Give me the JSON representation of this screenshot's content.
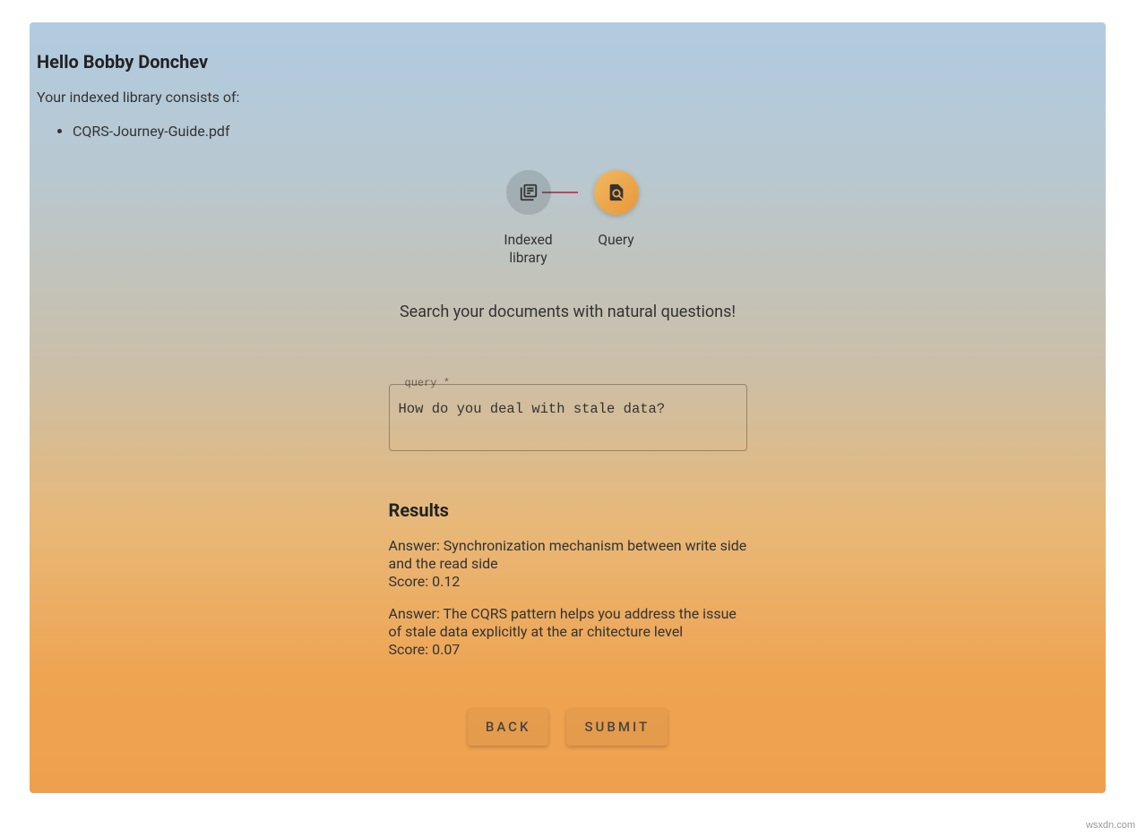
{
  "header": {
    "greeting": "Hello Bobby Donchev",
    "library_intro": "Your indexed library consists of:",
    "library_items": [
      "CQRS-Journey-Guide.pdf"
    ]
  },
  "stepper": {
    "step1_label": "Indexed library",
    "step2_label": "Query"
  },
  "search": {
    "prompt": "Search your documents with natural questions!",
    "query_label": "query *",
    "query_value": "How do you deal with stale data?"
  },
  "results": {
    "heading": "Results",
    "items": [
      {
        "answer": "Answer: Synchronization mechanism between write side and the read side",
        "score": "Score: 0.12"
      },
      {
        "answer": "Answer: The CQRS pattern helps you address the issue of stale data explicitly at the ar chitecture level",
        "score": "Score: 0.07"
      }
    ]
  },
  "buttons": {
    "back": "Back",
    "submit": "Submit"
  },
  "watermark": "wsxdn.com"
}
